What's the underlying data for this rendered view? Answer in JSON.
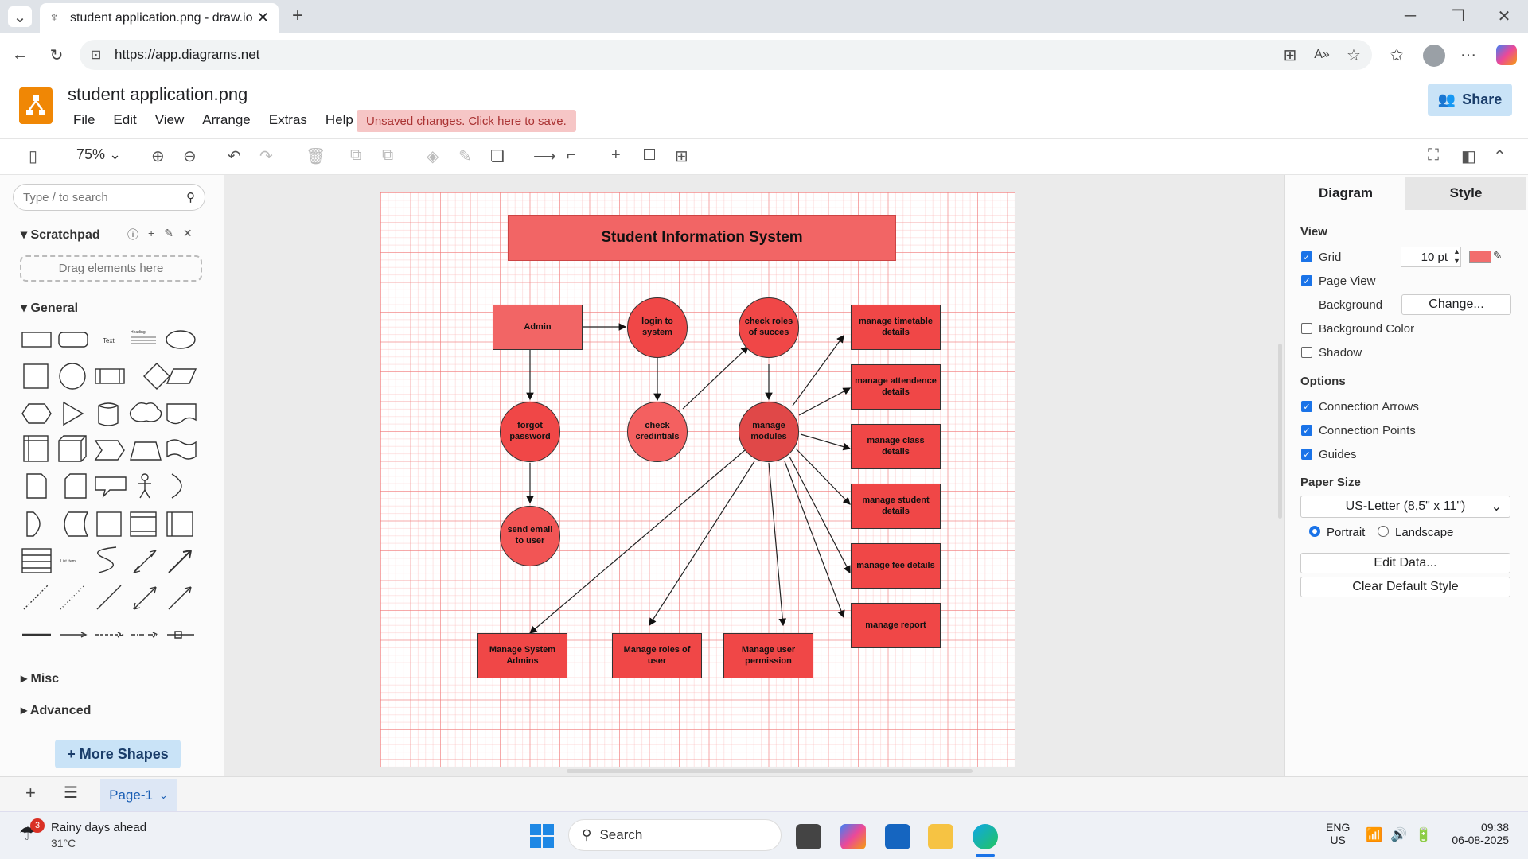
{
  "browser": {
    "tab_title": "student application.png - draw.io",
    "url": "https://app.diagrams.net"
  },
  "app": {
    "document_name": "student application.png",
    "menu": [
      "File",
      "Edit",
      "View",
      "Arrange",
      "Extras",
      "Help"
    ],
    "unsaved_notice": "Unsaved changes. Click here to save.",
    "share_label": "Share",
    "zoom": "75%"
  },
  "sidebar": {
    "search_placeholder": "Type / to search",
    "scratchpad_title": "Scratchpad",
    "drop_hint": "Drag elements here",
    "general_title": "General",
    "shape_text_label": "Text",
    "shape_heading_label": "Heading",
    "shape_list_label": "List Item",
    "misc_title": "Misc",
    "advanced_title": "Advanced",
    "more_shapes": "+ More Shapes"
  },
  "diagram": {
    "title": "Student Information System",
    "admin": "Admin",
    "login": "login to system",
    "check_roles": "check roles of succes",
    "forgot": "forgot password",
    "check_cred": "check credintials",
    "manage_modules": "manage modules",
    "send_email": "send email to user",
    "timetable": "manage timetable details",
    "attendence": "manage attendence details",
    "class": "manage class details",
    "student": "manage student details",
    "fee": "manage fee details",
    "report": "manage report",
    "sys_admins": "Manage System Admins",
    "roles_user": "Manage roles of user",
    "user_perm": "Manage user permission"
  },
  "format_panel": {
    "tab_diagram": "Diagram",
    "tab_style": "Style",
    "view_title": "View",
    "grid": "Grid",
    "grid_size": "10 pt",
    "grid_color": "#f26d6d",
    "page_view": "Page View",
    "background": "Background",
    "change_btn": "Change...",
    "background_color": "Background Color",
    "shadow": "Shadow",
    "options_title": "Options",
    "connection_arrows": "Connection Arrows",
    "connection_points": "Connection Points",
    "guides": "Guides",
    "paper_size_title": "Paper Size",
    "paper_size": "US-Letter (8,5\" x 11\")",
    "portrait": "Portrait",
    "landscape": "Landscape",
    "edit_data": "Edit Data...",
    "clear_style": "Clear Default Style"
  },
  "pages": {
    "current": "Page-1"
  },
  "taskbar": {
    "weather_badge": "3",
    "weather_title": "Rainy days ahead",
    "weather_temp": "31°C",
    "search": "Search",
    "lang": "ENG",
    "region": "US",
    "time": "09:38",
    "date": "06-08-2025"
  },
  "colors": {
    "node_fill": "#f04747",
    "title_fill": "#f26565",
    "accent": "#1a73e8"
  }
}
